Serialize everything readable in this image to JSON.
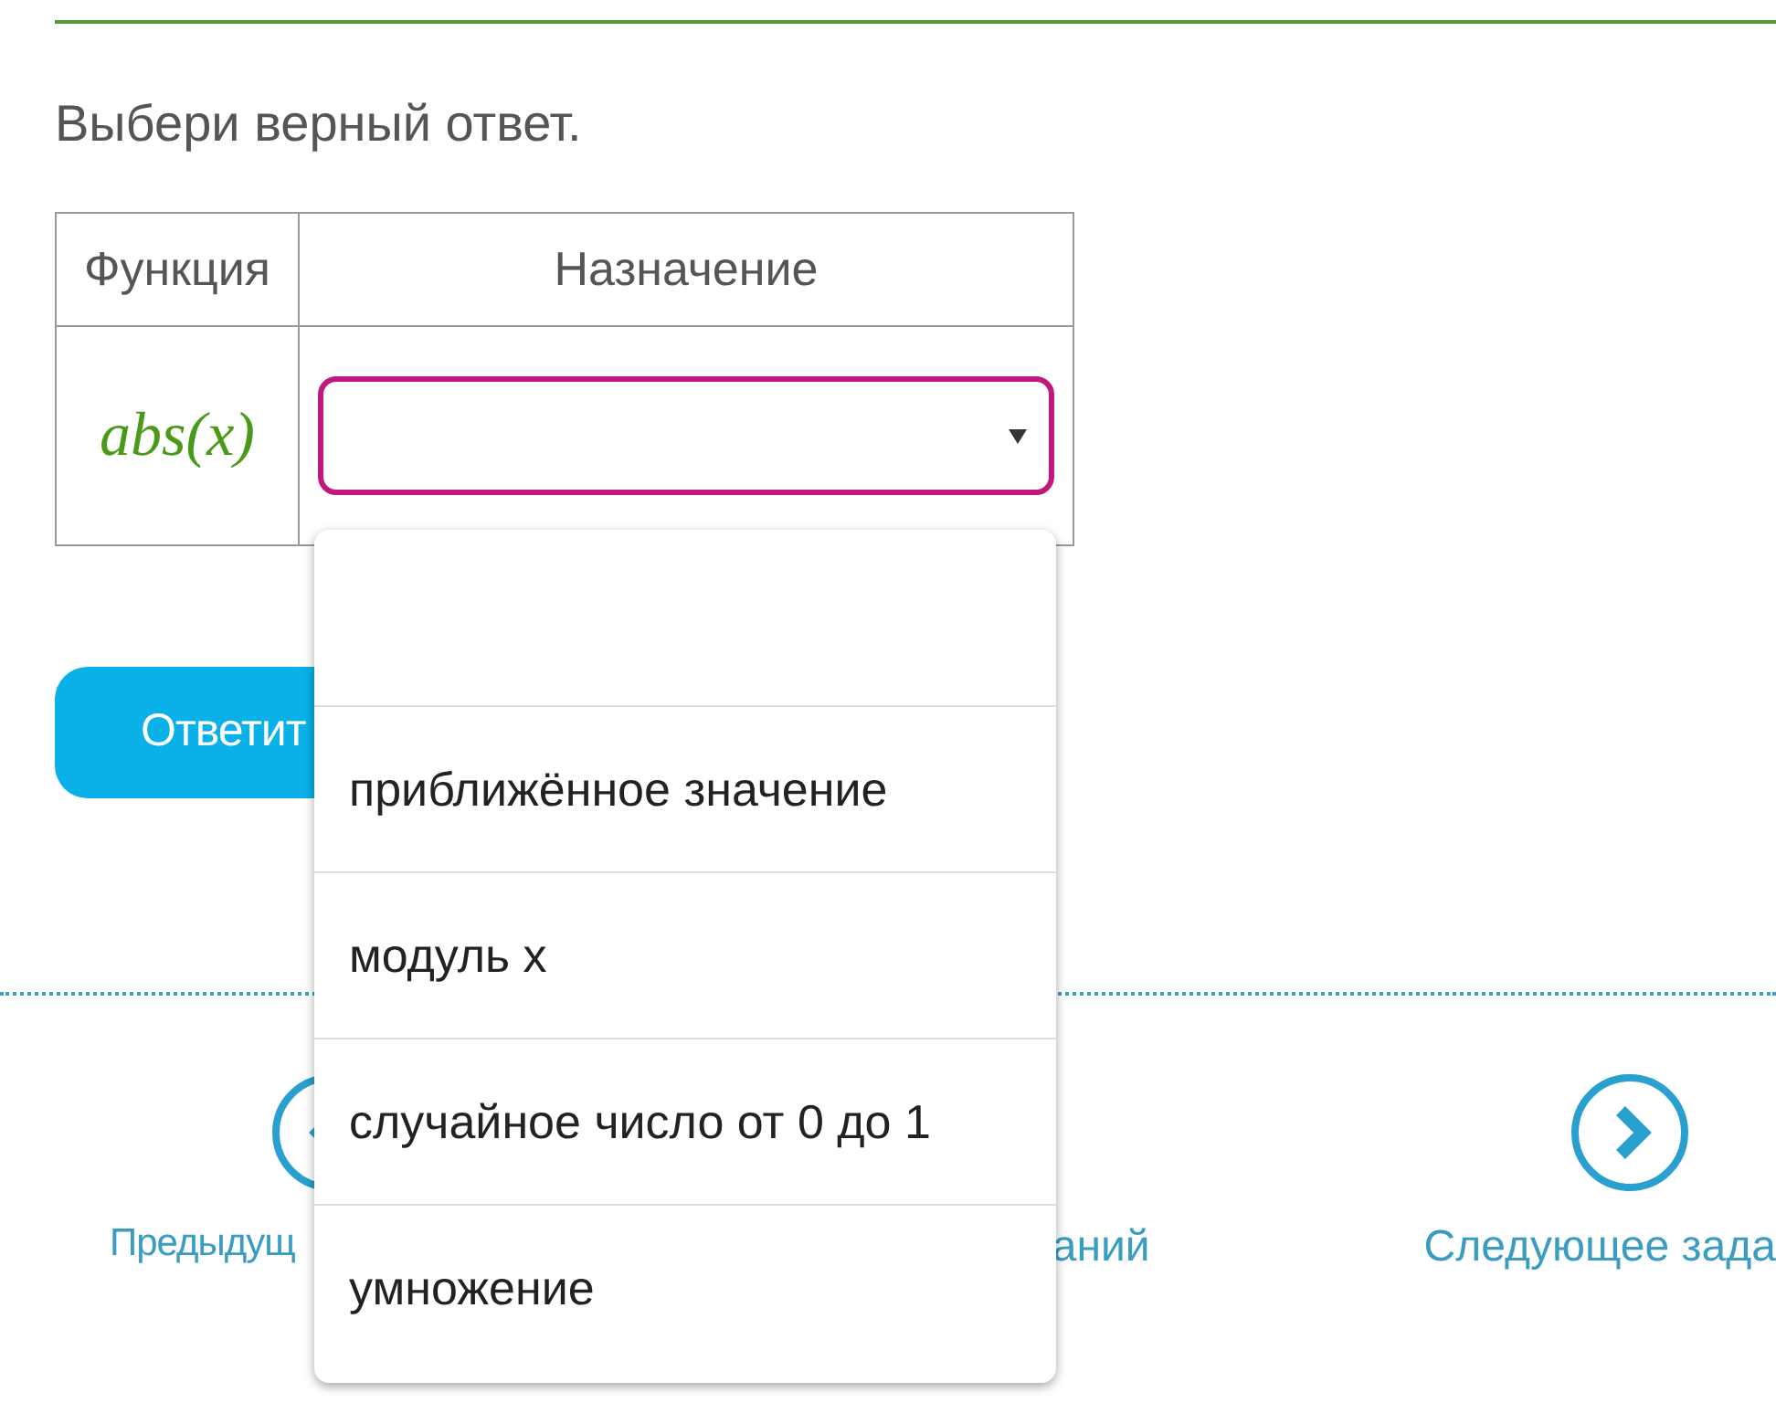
{
  "instruction": "Выбери верный ответ.",
  "table": {
    "columns": [
      "Функция",
      "Назначение"
    ],
    "rows": [
      {
        "function": "abs(x)",
        "select": {
          "open": true
        }
      }
    ]
  },
  "dropdown": {
    "options": [
      {
        "kind": "blank"
      },
      {
        "kind": "option",
        "label": "приближённое значение"
      },
      {
        "kind": "option",
        "label": "модуль x"
      },
      {
        "kind": "option",
        "label": "случайное число от 0 до 1"
      },
      {
        "kind": "option",
        "label": "умножение"
      }
    ]
  },
  "answer_button": "Ответит",
  "nav": {
    "previous": "Предыдущ",
    "middle": "аний",
    "next": "Следующее зада"
  }
}
